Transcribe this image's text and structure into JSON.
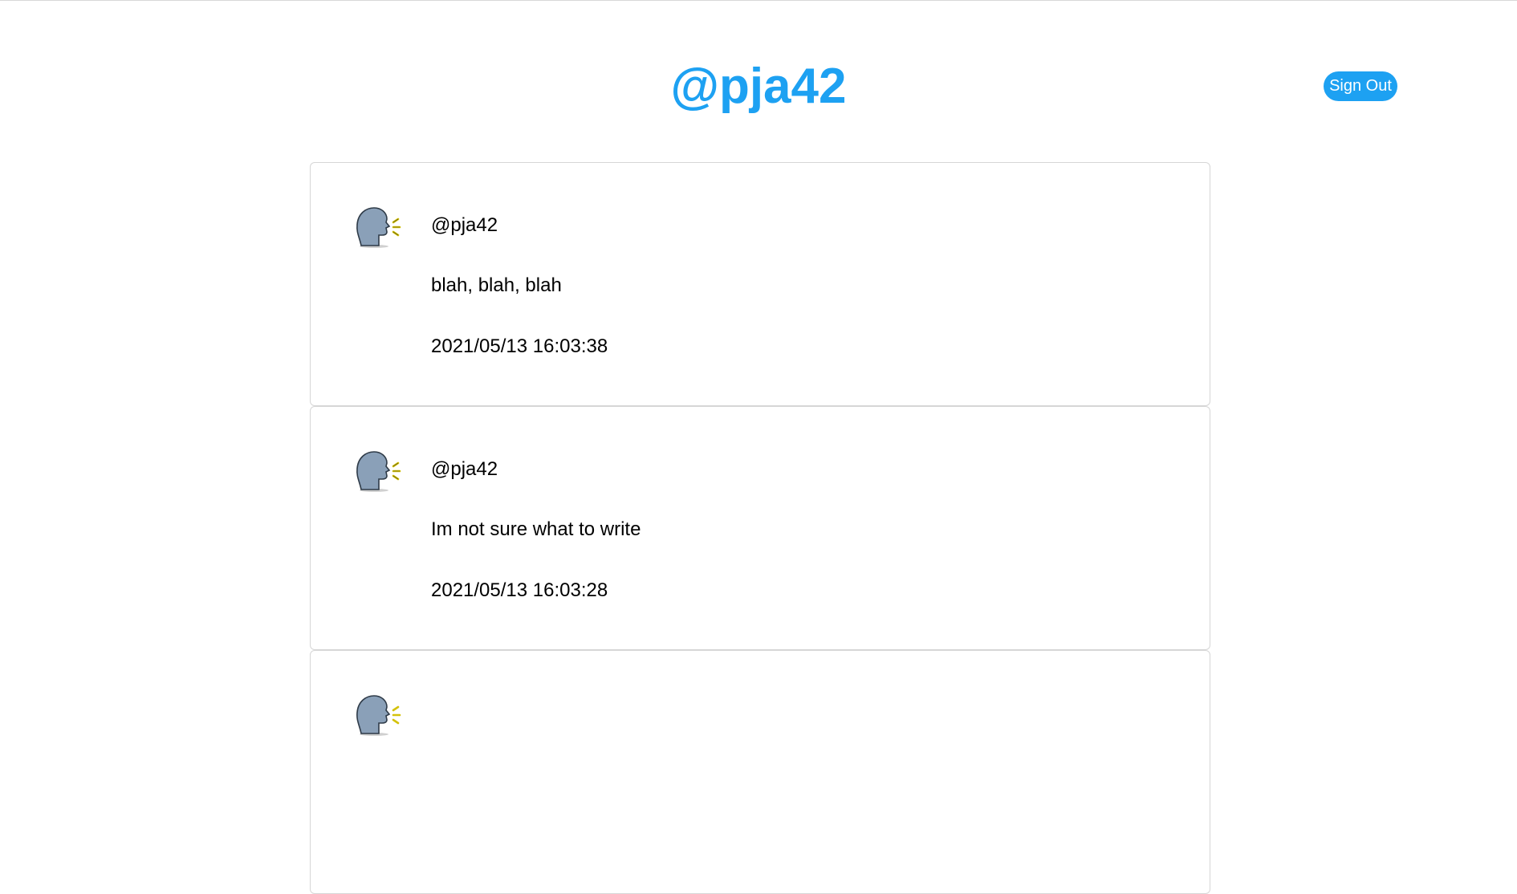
{
  "header": {
    "title": "@pja42",
    "signout_label": "Sign Out"
  },
  "colors": {
    "accent": "#1da1f2"
  },
  "posts": [
    {
      "avatar_icon": "speaking-head-icon",
      "username": "@pja42",
      "body": "blah, blah, blah",
      "timestamp": "2021/05/13 16:03:38"
    },
    {
      "avatar_icon": "speaking-head-icon",
      "username": "@pja42",
      "body": "Im not sure what to write",
      "timestamp": "2021/05/13 16:03:28"
    },
    {
      "avatar_icon": "speaking-head-icon",
      "username": "",
      "body": "",
      "timestamp": ""
    }
  ]
}
